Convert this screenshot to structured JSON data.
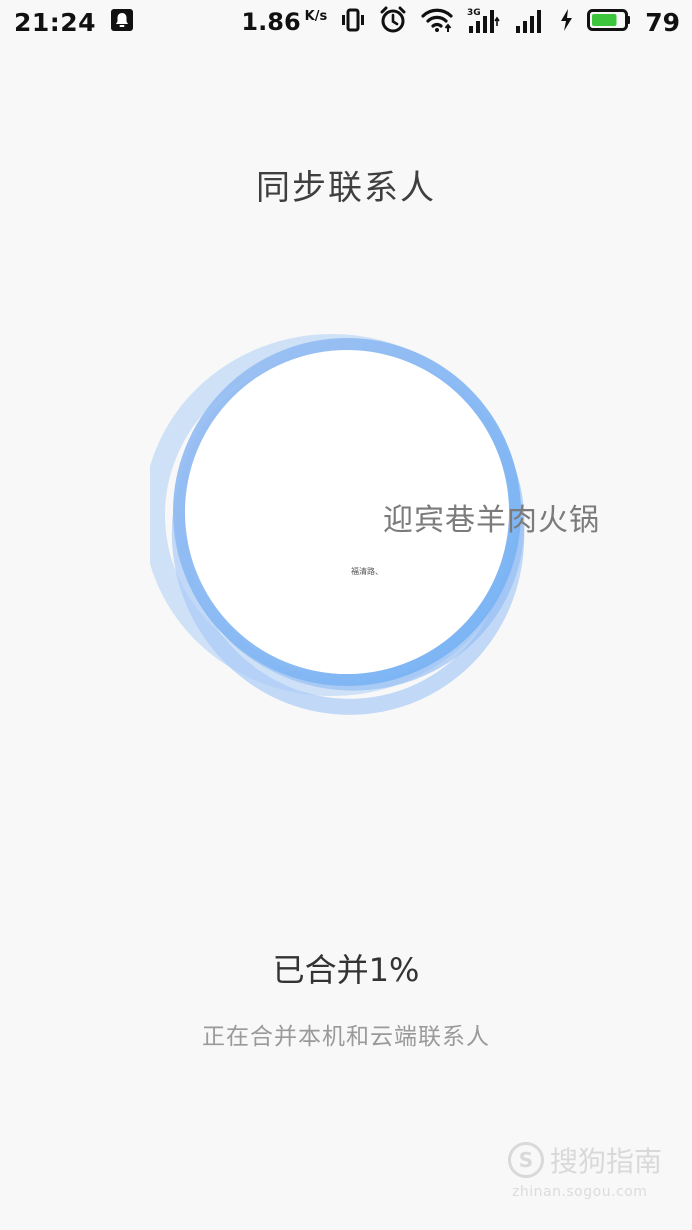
{
  "status_bar": {
    "time": "21:24",
    "net_speed": "1.86",
    "net_unit": "K/s",
    "network_type": "3G",
    "battery_percent": "79",
    "battery_level": 0.79,
    "battery_color": "#3ec53e",
    "icons": [
      "qq-bell-icon",
      "vibrate-icon",
      "alarm-icon",
      "wifi-icon",
      "signal-3g-icon",
      "signal-icon",
      "charging-icon",
      "battery-icon"
    ]
  },
  "page": {
    "title": "同步联系人"
  },
  "animation": {
    "floating_contact": "迎宾巷羊肉火锅",
    "tiny_contact": "福清路、",
    "ring_colors": [
      "#8ab4f0",
      "#7ab8f5",
      "#b8d4f5"
    ]
  },
  "progress": {
    "status": "已合并1%",
    "percent": 1,
    "description": "正在合并本机和云端联系人"
  },
  "watermark": {
    "logo_letter": "S",
    "brand": "搜狗指南",
    "url": "zhinan.sogou.com"
  }
}
